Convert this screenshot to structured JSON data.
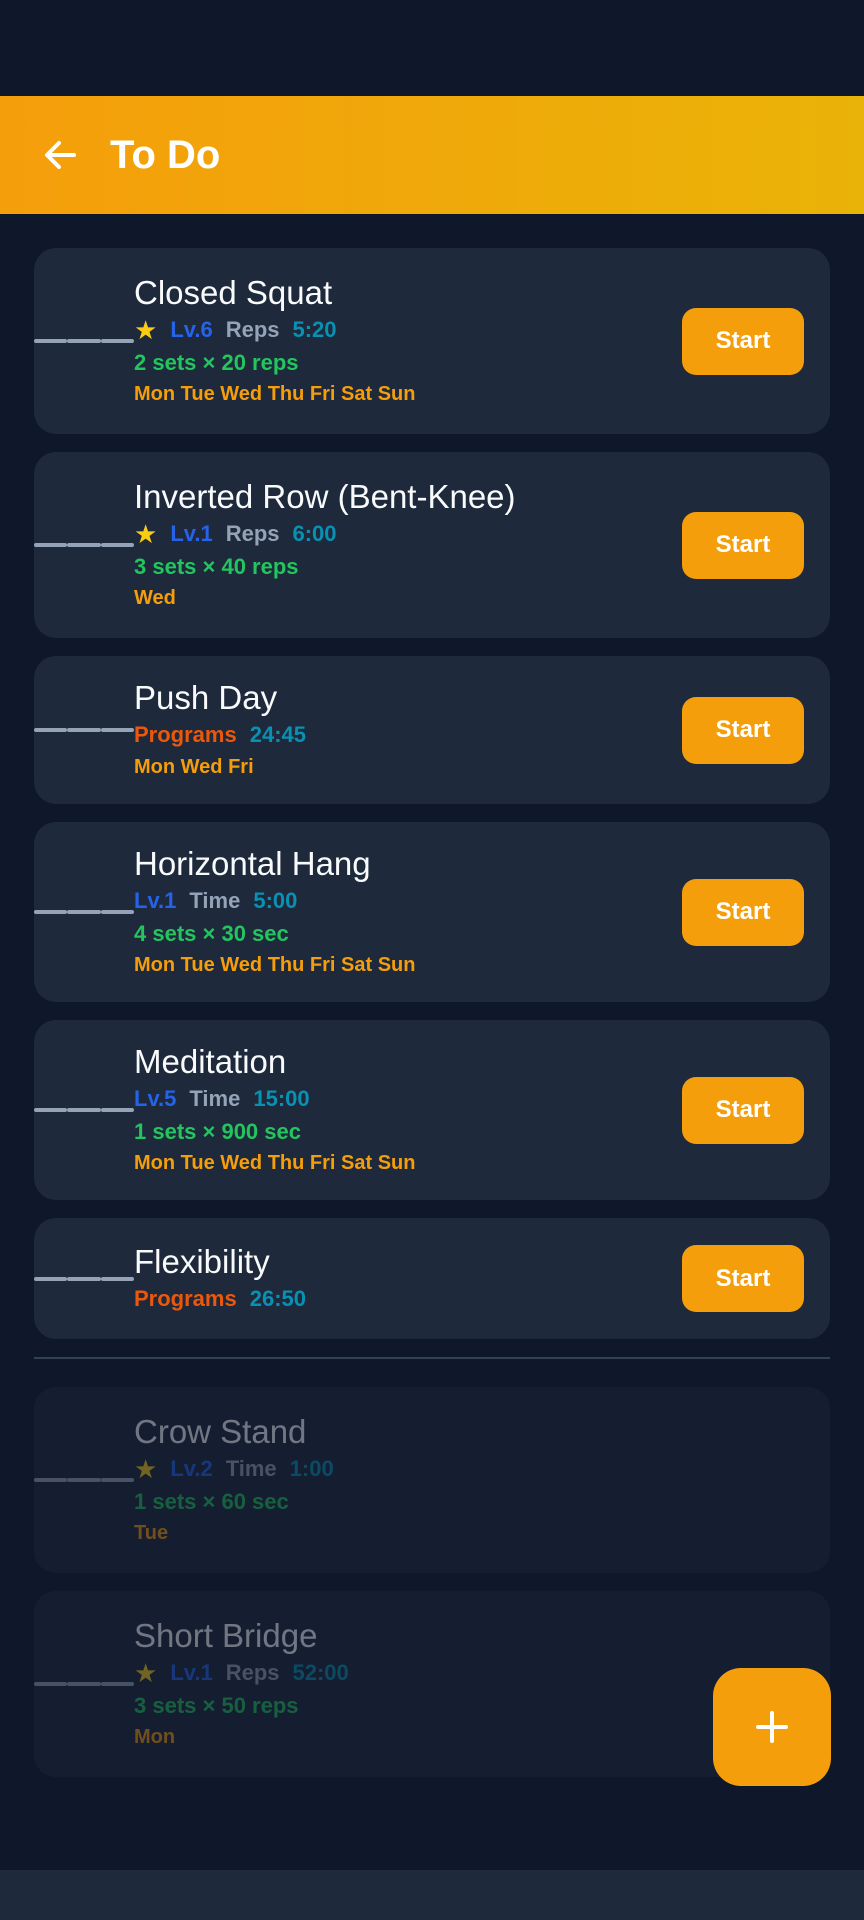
{
  "header": {
    "title": "To Do"
  },
  "labels": {
    "start": "Start"
  },
  "items": [
    {
      "name": "Closed Squat",
      "star": "★",
      "level": "Lv.6",
      "kind": "Reps",
      "duration": "5:20",
      "sets": "2 sets × 20 reps",
      "days": "Mon Tue Wed Thu Fri Sat Sun"
    },
    {
      "name": "Inverted Row (Bent-Knee)",
      "star": "★",
      "level": "Lv.1",
      "kind": "Reps",
      "duration": "6:00",
      "sets": "3 sets × 40 reps",
      "days": "Wed"
    },
    {
      "name": "Push Day",
      "kind": "Programs",
      "duration": "24:45",
      "days": "Mon Wed Fri"
    },
    {
      "name": "Horizontal Hang",
      "level": "Lv.1",
      "kind": "Time",
      "duration": "5:00",
      "sets": "4 sets × 30 sec",
      "days": "Mon Tue Wed Thu Fri Sat Sun"
    },
    {
      "name": "Meditation",
      "level": "Lv.5",
      "kind": "Time",
      "duration": "15:00",
      "sets": "1 sets × 900 sec",
      "days": "Mon Tue Wed Thu Fri Sat Sun"
    },
    {
      "name": "Flexibility",
      "kind": "Programs",
      "duration": "26:50"
    }
  ],
  "completed": [
    {
      "name": "Crow Stand",
      "star": "★",
      "level": "Lv.2",
      "kind": "Time",
      "duration": "1:00",
      "sets": "1 sets × 60 sec",
      "days": "Tue"
    },
    {
      "name": "Short Bridge",
      "star": "★",
      "level": "Lv.1",
      "kind": "Reps",
      "duration": "52:00",
      "sets": "3 sets × 50 reps",
      "days": "Mon"
    }
  ],
  "icons": {
    "back": "arrow-left-icon",
    "handle": "drag-handle-icon",
    "fab": "plus-icon"
  },
  "colors": {
    "accent": "#f59e0b",
    "background": "#0f172a",
    "card": "#1e293b"
  }
}
